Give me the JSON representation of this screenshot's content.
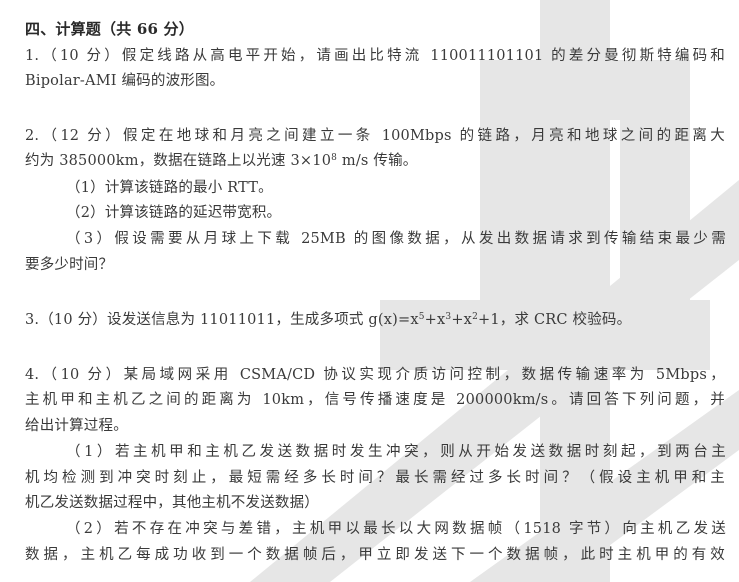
{
  "section": {
    "title": "四、计算题（共 66 分）"
  },
  "q1": {
    "line1": "1.（10 分）假定线路从高电平开始，请画出比特流 110011101101 的差分曼彻斯特编码和",
    "line2": "Bipolar-AMI 编码的波形图。"
  },
  "q2": {
    "line1": "2.（12 分）假定在地球和月亮之间建立一条 100Mbps 的链路，月亮和地球之间的距离大",
    "line2_pre": "约为 385000km，数据在链路上以光速 3×10",
    "line2_exp": "8",
    "line2_post": " m/s 传输。",
    "sub1": "（1）计算该链路的最小 RTT。",
    "sub2": "（2）计算该链路的延迟带宽积。",
    "sub3_line1": "（3）假设需要从月球上下载 25MB 的图像数据，从发出数据请求到传输结束最少需",
    "sub3_line2": "要多少时间？"
  },
  "q3": {
    "pre": "3.（10 分）设发送信息为 11011011，生成多项式 g(x)=x",
    "e1": "5",
    "mid1": "+x",
    "e2": "3",
    "mid2": "+x",
    "e3": "2",
    "post": "+1，求 CRC 校验码。"
  },
  "q4": {
    "line1": "4.（10 分）某局域网采用 CSMA/CD 协议实现介质访问控制，数据传输速率为 5Mbps，",
    "line2": "主机甲和主机乙之间的距离为 10km，信号传播速度是 200000km/s。请回答下列问题，并",
    "line3": "给出计算过程。",
    "sub1_line1": "（1）若主机甲和主机乙发送数据时发生冲突，则从开始发送数据时刻起，到两台主",
    "sub1_line2": "机均检测到冲突时刻止，最短需经多长时间？最长需经过多长时间？（假设主机甲和主",
    "sub1_line3": "机乙发送数据过程中，其他主机不发送数据）",
    "sub2_line1": "（2）若不存在冲突与差错，主机甲以最长以大网数据帧（1518 字节）向主机乙发送",
    "sub2_line2": "数据，主机乙每成功收到一个数据帧后，甲立即发送下一个数据帧，此时主机甲的有效"
  },
  "colors": {
    "text": "#3a3a3a",
    "watermark": "#cfcfcf"
  }
}
